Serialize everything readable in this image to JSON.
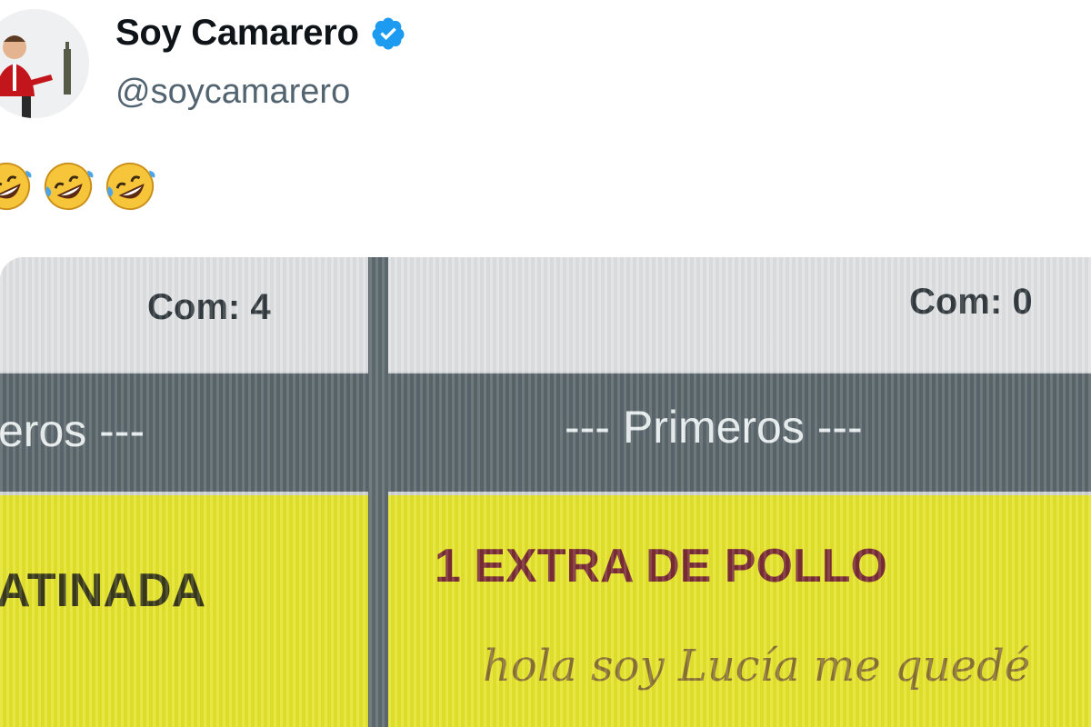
{
  "tweet": {
    "author_name": "Soy Camarero",
    "handle": "@soycamarero",
    "verified": true,
    "emojis": [
      "rolling-on-floor-laughing-emoji",
      "rolling-on-floor-laughing-emoji",
      "rolling-on-floor-laughing-emoji"
    ]
  },
  "photo": {
    "left_column": {
      "com_label": "Com: 4",
      "section_header": "eros ---",
      "item": "ATINADA"
    },
    "right_column": {
      "com_label": "Com: 0",
      "section_header": "--- Primeros ---",
      "item": "1 EXTRA DE POLLO",
      "note": "hola soy Lucía me quedé"
    }
  },
  "colors": {
    "verified_blue": "#1d9bf0",
    "ticket_yellow": "#e5e32b",
    "header_band": "#5a666b",
    "item_red": "#7a2c34"
  }
}
